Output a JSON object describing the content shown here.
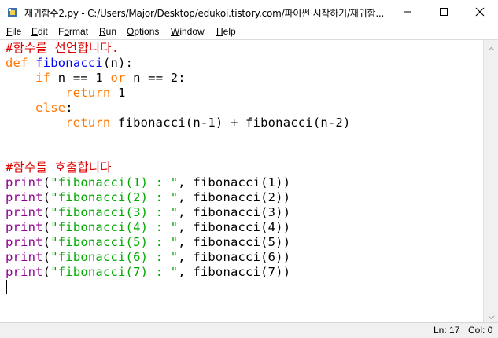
{
  "window": {
    "title": "재귀함수2.py - C:/Users/Major/Desktop/edukoi.tistory.com/파이썬 시작하기/재귀함...",
    "buttons": [
      "minimize-icon",
      "maximize-icon",
      "close-icon"
    ]
  },
  "menu": [
    {
      "label": "File",
      "underline": "F",
      "rest": "ile"
    },
    {
      "label": "Edit",
      "underline": "E",
      "rest": "dit"
    },
    {
      "label": "Format",
      "pre": "F",
      "underline": "o",
      "rest": "rmat"
    },
    {
      "label": "Run",
      "underline": "R",
      "rest": "un"
    },
    {
      "label": "Options",
      "underline": "O",
      "rest": "ptions"
    },
    {
      "label": "Window",
      "underline": "W",
      "rest": "indow"
    },
    {
      "label": "Help",
      "underline": "H",
      "rest": "elp"
    }
  ],
  "code": {
    "line1": "#함수를 선언합니다.",
    "line2": {
      "kw": "def",
      "name": "fibonacci",
      "rest": "(n):"
    },
    "line3": {
      "indent": "    ",
      "kw1": "if",
      "mid": " n == 1 ",
      "kw2": "or",
      "rest": " n == 2:"
    },
    "line4": {
      "indent": "        ",
      "kw": "return",
      "rest": " 1"
    },
    "line5": {
      "indent": "    ",
      "kw": "else",
      "rest": ":"
    },
    "line6": {
      "indent": "        ",
      "kw": "return",
      "rest": " fibonacci(n-1) + fibonacci(n-2)"
    },
    "line9": "#함수를 호출합니다",
    "prints": [
      {
        "fn": "print",
        "open": "(",
        "str": "\"fibonacci(1) : \"",
        "rest": ", fibonacci(1))"
      },
      {
        "fn": "print",
        "open": "(",
        "str": "\"fibonacci(2) : \"",
        "rest": ", fibonacci(2))"
      },
      {
        "fn": "print",
        "open": "(",
        "str": "\"fibonacci(3) : \"",
        "rest": ", fibonacci(3))"
      },
      {
        "fn": "print",
        "open": "(",
        "str": "\"fibonacci(4) : \"",
        "rest": ", fibonacci(4))"
      },
      {
        "fn": "print",
        "open": "(",
        "str": "\"fibonacci(5) : \"",
        "rest": ", fibonacci(5))"
      },
      {
        "fn": "print",
        "open": "(",
        "str": "\"fibonacci(6) : \"",
        "rest": ", fibonacci(6))"
      },
      {
        "fn": "print",
        "open": "(",
        "str": "\"fibonacci(7) : \"",
        "rest": ", fibonacci(7))"
      }
    ]
  },
  "status": {
    "line": "Ln: 17",
    "col": "Col: 0"
  },
  "colors": {
    "keyword": "#ff7700",
    "builtin": "#900090",
    "string": "#00aa00",
    "comment": "#dd0000",
    "definition": "#0000ff"
  }
}
